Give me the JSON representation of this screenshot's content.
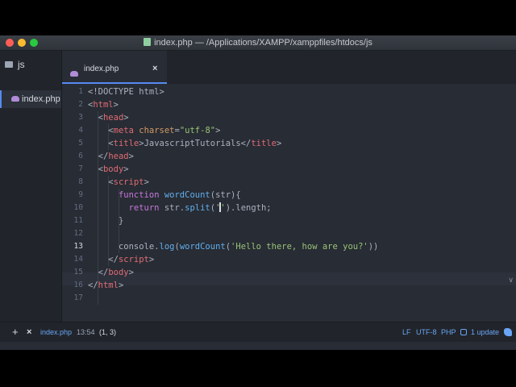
{
  "window": {
    "title": "index.php — /Applications/XAMPP/xamppfiles/htdocs/js"
  },
  "tree": {
    "root": "js",
    "file": "index.php"
  },
  "tab": {
    "label": "index.php",
    "close": "×"
  },
  "editor": {
    "line_numbers": [
      "1",
      "2",
      "3",
      "4",
      "5",
      "6",
      "7",
      "8",
      "9",
      "10",
      "11",
      "12",
      "13",
      "14",
      "15",
      "16",
      "17"
    ],
    "active_line": 13,
    "lines": {
      "l1": {
        "text": "<!DOCTYPE html>"
      },
      "l2": {
        "open": "<",
        "tag": "html",
        "close": ">"
      },
      "l3": {
        "open": "<",
        "tag": "head",
        "close": ">"
      },
      "l4": {
        "open": "<",
        "tag": "meta",
        "attr": "charset",
        "eq": "=",
        "val": "\"utf-8\"",
        "close": ">"
      },
      "l5": {
        "open": "<",
        "tag": "title",
        "close": ">",
        "text": "JavascriptTutorials",
        "open2": "</",
        "tag2": "title",
        "close2": ">"
      },
      "l6": {
        "open": "</",
        "tag": "head",
        "close": ">"
      },
      "l7": {
        "open": "<",
        "tag": "body",
        "close": ">"
      },
      "l8": {
        "open": "<",
        "tag": "script",
        "close": ">"
      },
      "l9": {
        "kw": "function",
        "fn": "wordCount",
        "rest": "(str){"
      },
      "l10": {
        "kw": "return",
        "a": "str.",
        "fn": "split",
        "b": "(",
        "str1": "'",
        "str2": "'",
        "c": ").length;"
      },
      "l11": {
        "text": "}"
      },
      "l13": {
        "a": "console.",
        "fn": "log",
        "b": "(",
        "fn2": "wordCount",
        "c": "(",
        "str": "'Hello there, how are you?'",
        "d": "))"
      },
      "l14": {
        "open": "</",
        "tag": "script",
        "close": ">"
      },
      "l15": {
        "open": "</",
        "tag": "body",
        "close": ">"
      },
      "l16": {
        "open": "</",
        "tag": "html",
        "close": ">"
      }
    }
  },
  "status": {
    "add": "+",
    "close": "×",
    "file": "index.php",
    "time": "13:54",
    "position": "(1, 3)",
    "line_ending": "LF",
    "encoding": "UTF-8",
    "grammar": "PHP",
    "updates": "1 update"
  },
  "colors": {
    "editor_bg": "#282c34",
    "panel_bg": "#21252b",
    "accent": "#568af2",
    "tag": "#e06c75",
    "attribute": "#d19a66",
    "string": "#98c379",
    "keyword": "#c678dd",
    "function": "#61afef"
  }
}
